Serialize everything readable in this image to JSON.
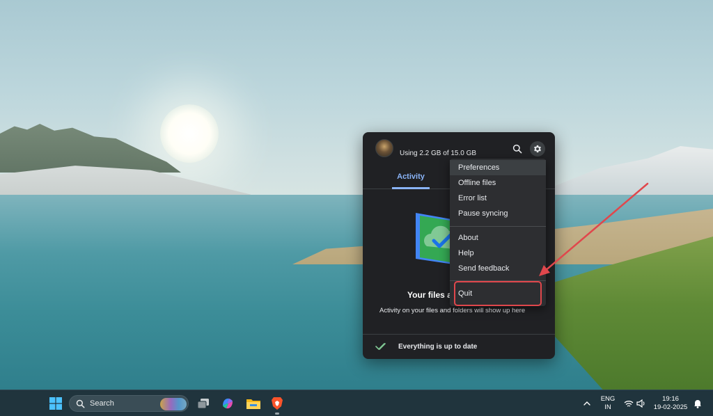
{
  "drive_popup": {
    "storage_usage": "Using 2.2 GB of 15.0 GB",
    "tabs": [
      {
        "label": "Activity",
        "active": true
      }
    ],
    "status_title": "Your files a",
    "status_description": "Activity on your files and folders will show up here",
    "footer_status": "Everything is up to date",
    "icons": {
      "avatar": "avatar",
      "search": "search-icon",
      "settings": "gear-icon",
      "illustration": "cloud-check-folder-icon",
      "footer": "double-check-icon"
    }
  },
  "settings_menu": {
    "group1": [
      "Preferences",
      "Offline files",
      "Error list",
      "Pause syncing"
    ],
    "group2": [
      "About",
      "Help",
      "Send feedback"
    ],
    "group3": [
      "Quit"
    ],
    "hovered_item": "Preferences",
    "highlighted_item": "Quit"
  },
  "annotation": {
    "color": "#e0474c"
  },
  "taskbar": {
    "search_label": "Search",
    "language_line1": "ENG",
    "language_line2": "IN",
    "time": "19:16",
    "date": "19-02-2025",
    "icons": [
      "windows-start-icon",
      "search-icon",
      "task-view-icon",
      "copilot-icon",
      "file-explorer-icon",
      "brave-browser-icon",
      "chevron-up-icon",
      "wifi-icon",
      "volume-icon",
      "notification-bell-icon"
    ]
  },
  "colors": {
    "popup_bg": "#202124",
    "menu_bg": "#2d2e31",
    "accent_blue": "#8ab4f8",
    "success_green": "#81c995",
    "taskbar_bg": "#20343d"
  }
}
